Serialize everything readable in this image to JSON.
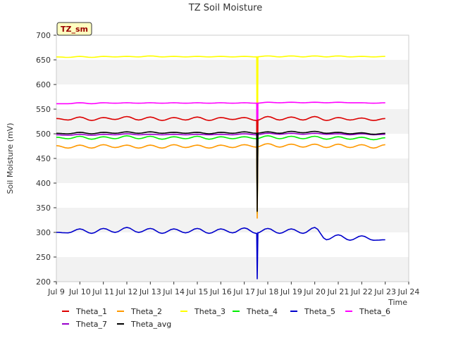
{
  "chart_data": {
    "type": "line",
    "title": "TZ Soil Moisture",
    "ylabel": "Soil Moisture (mV)",
    "xlabel": "Time",
    "badge": "TZ_sm",
    "xlim": [
      9,
      24
    ],
    "ylim": [
      200,
      700
    ],
    "x_ticks": [
      "Jul 9",
      "Jul 10",
      "Jul 11",
      "Jul 12",
      "Jul 13",
      "Jul 14",
      "Jul 15",
      "Jul 16",
      "Jul 17",
      "Jul 18",
      "Jul 19",
      "Jul 20",
      "Jul 21",
      "Jul 22",
      "Jul 23",
      "Jul 24"
    ],
    "y_ticks": [
      200,
      250,
      300,
      350,
      400,
      450,
      500,
      550,
      600,
      650,
      700
    ],
    "grid": "horizontal alternating bands",
    "legend_placement": "bottom",
    "series": [
      {
        "name": "Theta_1",
        "color": "#dd0000",
        "base": 530,
        "amp": 4,
        "drop_to": 340,
        "x": [
          9.0,
          9.5,
          10.0,
          10.5,
          11.0,
          11.5,
          12.0,
          12.5,
          13.0,
          13.5,
          14.0,
          14.5,
          15.0,
          15.5,
          16.0,
          16.5,
          17.0,
          17.5,
          18.0,
          18.5,
          19.0,
          19.5,
          20.0,
          20.5,
          21.0,
          21.5,
          22.0,
          22.5,
          23.0
        ],
        "y": [
          531,
          528,
          534,
          527,
          533,
          529,
          535,
          528,
          534,
          527,
          533,
          528,
          534,
          527,
          533,
          529,
          533,
          527,
          535,
          528,
          534,
          528,
          535,
          527,
          533,
          528,
          532,
          527,
          531
        ]
      },
      {
        "name": "Theta_2",
        "color": "#ff9900",
        "base": 475,
        "amp": 4,
        "drop_to": 328,
        "x": [
          9.0,
          9.5,
          10.0,
          10.5,
          11.0,
          11.5,
          12.0,
          12.5,
          13.0,
          13.5,
          14.0,
          14.5,
          15.0,
          15.5,
          16.0,
          16.5,
          17.0,
          17.5,
          18.0,
          18.5,
          19.0,
          19.5,
          20.0,
          20.5,
          21.0,
          21.5,
          22.0,
          22.5,
          23.0
        ],
        "y": [
          476,
          471,
          477,
          471,
          478,
          472,
          477,
          471,
          477,
          471,
          478,
          472,
          477,
          471,
          477,
          472,
          478,
          473,
          480,
          473,
          479,
          473,
          479,
          472,
          479,
          472,
          478,
          471,
          478
        ]
      },
      {
        "name": "Theta_3",
        "color": "#ffff00",
        "base": 656,
        "amp": 1.5,
        "drop_to": 345,
        "x": [
          9.0,
          9.5,
          10.0,
          10.5,
          11.0,
          11.5,
          12.0,
          12.5,
          13.0,
          13.5,
          14.0,
          14.5,
          15.0,
          15.5,
          16.0,
          16.5,
          17.0,
          17.5,
          18.0,
          18.5,
          19.0,
          19.5,
          20.0,
          20.5,
          21.0,
          21.5,
          22.0,
          22.5,
          23.0
        ],
        "y": [
          656,
          655,
          657,
          655,
          657,
          656,
          657,
          656,
          658,
          656,
          657,
          656,
          657,
          656,
          657,
          656,
          657,
          656,
          658,
          656,
          658,
          656,
          658,
          656,
          658,
          656,
          657,
          656,
          657
        ]
      },
      {
        "name": "Theta_4",
        "color": "#00ee00",
        "base": 492,
        "amp": 3,
        "drop_to": 338,
        "x": [
          9.0,
          9.5,
          10.0,
          10.5,
          11.0,
          11.5,
          12.0,
          12.5,
          13.0,
          13.5,
          14.0,
          14.5,
          15.0,
          15.5,
          16.0,
          16.5,
          17.0,
          17.5,
          18.0,
          18.5,
          19.0,
          19.5,
          20.0,
          20.5,
          21.0,
          21.5,
          22.0,
          22.5,
          23.0
        ],
        "y": [
          493,
          490,
          495,
          489,
          494,
          490,
          496,
          490,
          495,
          489,
          494,
          490,
          495,
          489,
          494,
          490,
          494,
          490,
          496,
          490,
          495,
          490,
          495,
          489,
          494,
          489,
          493,
          488,
          492
        ]
      },
      {
        "name": "Theta_5",
        "color": "#0000cc",
        "base": 302,
        "amp": 5,
        "drop_to": 205,
        "x": [
          9.0,
          9.5,
          10.0,
          10.5,
          11.0,
          11.5,
          12.0,
          12.5,
          13.0,
          13.5,
          14.0,
          14.5,
          15.0,
          15.5,
          16.0,
          16.5,
          17.0,
          17.5,
          18.0,
          18.5,
          19.0,
          19.5,
          20.0,
          20.5,
          21.0,
          21.5,
          22.0,
          22.5,
          23.0
        ],
        "y": [
          300,
          299,
          307,
          298,
          308,
          300,
          310,
          300,
          308,
          298,
          307,
          299,
          308,
          298,
          307,
          299,
          309,
          298,
          308,
          298,
          307,
          298,
          310,
          285,
          295,
          284,
          293,
          284,
          285
        ]
      },
      {
        "name": "Theta_6",
        "color": "#ff00ff",
        "base": 562,
        "amp": 1.5,
        "drop_to": 352,
        "x": [
          9.0,
          9.5,
          10.0,
          10.5,
          11.0,
          11.5,
          12.0,
          12.5,
          13.0,
          13.5,
          14.0,
          14.5,
          15.0,
          15.5,
          16.0,
          16.5,
          17.0,
          17.5,
          18.0,
          18.5,
          19.0,
          19.5,
          20.0,
          20.5,
          21.0,
          21.5,
          22.0,
          22.5,
          23.0
        ],
        "y": [
          561,
          561,
          563,
          561,
          563,
          562,
          563,
          562,
          563,
          562,
          563,
          562,
          563,
          562,
          563,
          562,
          563,
          562,
          564,
          563,
          564,
          563,
          564,
          563,
          564,
          563,
          563,
          562,
          563
        ]
      },
      {
        "name": "Theta_7",
        "color": "#9900cc",
        "base": 499,
        "amp": 1.5,
        "drop_to": 350,
        "x": [
          9.0,
          9.5,
          10.0,
          10.5,
          11.0,
          11.5,
          12.0,
          12.5,
          13.0,
          13.5,
          14.0,
          14.5,
          15.0,
          15.5,
          16.0,
          16.5,
          17.0,
          17.5,
          18.0,
          18.5,
          19.0,
          19.5,
          20.0,
          20.5,
          21.0,
          21.5,
          22.0,
          22.5,
          23.0
        ],
        "y": [
          498,
          497,
          499,
          497,
          499,
          498,
          500,
          498,
          499,
          498,
          499,
          498,
          499,
          498,
          499,
          498,
          500,
          498,
          501,
          499,
          501,
          499,
          501,
          499,
          500,
          498,
          500,
          498,
          499
        ]
      },
      {
        "name": "Theta_avg",
        "color": "#000000",
        "base": 502,
        "amp": 2,
        "drop_to": 342,
        "x": [
          9.0,
          9.5,
          10.0,
          10.5,
          11.0,
          11.5,
          12.0,
          12.5,
          13.0,
          13.5,
          14.0,
          14.5,
          15.0,
          15.5,
          16.0,
          16.5,
          17.0,
          17.5,
          18.0,
          18.5,
          19.0,
          19.5,
          20.0,
          20.5,
          21.0,
          21.5,
          22.0,
          22.5,
          23.0
        ],
        "y": [
          501,
          500,
          503,
          500,
          503,
          501,
          504,
          501,
          504,
          501,
          503,
          501,
          503,
          500,
          503,
          501,
          504,
          501,
          504,
          501,
          505,
          502,
          505,
          501,
          503,
          500,
          502,
          499,
          501
        ]
      }
    ],
    "dropout_x": 17.55
  }
}
